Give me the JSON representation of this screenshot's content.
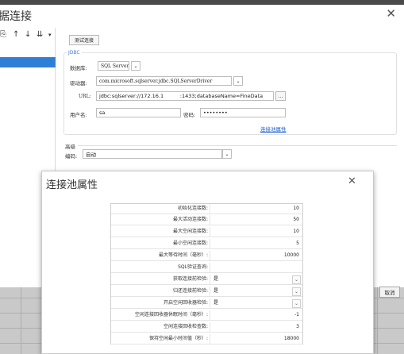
{
  "window": {
    "title": "据连接",
    "close_icon": "close-icon"
  },
  "toolbar": {
    "icons": [
      "copy-icon",
      "arrow-up-icon",
      "arrow-down-icon",
      "sort-icon",
      "more-icon"
    ],
    "glyphs": [
      "⎘",
      "↑",
      "↓",
      "⇊",
      "▾"
    ]
  },
  "form": {
    "test_button": "测试连接",
    "jdbc_group": "JDBC",
    "database_label": "数据库:",
    "database_value": "SQL Server",
    "driver_label": "驱动器:",
    "driver_value": "com.microsoft.sqlserver.jdbc.SQLServerDriver",
    "url_label": "URL:",
    "url_value": "jdbc:sqlserver://172.16.1          :1433;databaseName=FineData",
    "url_more": "...",
    "username_label": "用户名:",
    "username_value": "sa",
    "password_label": "密码:",
    "password_value": "••••••••",
    "pool_link": "连接池属性",
    "advanced_label": "高级",
    "encoding_label": "编码:",
    "encoding_value": "自动"
  },
  "cancel_button": "取消",
  "pool_dialog": {
    "title": "连接池属性",
    "rows": [
      {
        "label": "初始化连接数:",
        "value": "10",
        "kind": "num"
      },
      {
        "label": "最大活动连接数:",
        "value": "50",
        "kind": "num"
      },
      {
        "label": "最大空闲连接数:",
        "value": "10",
        "kind": "num"
      },
      {
        "label": "最小空闲连接数:",
        "value": "5",
        "kind": "num"
      },
      {
        "label": "最大等待时间（毫秒）:",
        "value": "10000",
        "kind": "num"
      },
      {
        "label": "SQL验证查询:",
        "value": "",
        "kind": "text"
      },
      {
        "label": "获取连接前检验:",
        "value": "是",
        "kind": "select"
      },
      {
        "label": "归还连接前检验:",
        "value": "是",
        "kind": "select"
      },
      {
        "label": "开启空闲回收器检验:",
        "value": "是",
        "kind": "select"
      },
      {
        "label": "空闲连接回收器休眠时间（毫秒）:",
        "value": "-1",
        "kind": "num"
      },
      {
        "label": "空闲连接回收检查数:",
        "value": "3",
        "kind": "num"
      },
      {
        "label": "保持空闲最小时间值（秒）:",
        "value": "18000",
        "kind": "num"
      }
    ]
  }
}
